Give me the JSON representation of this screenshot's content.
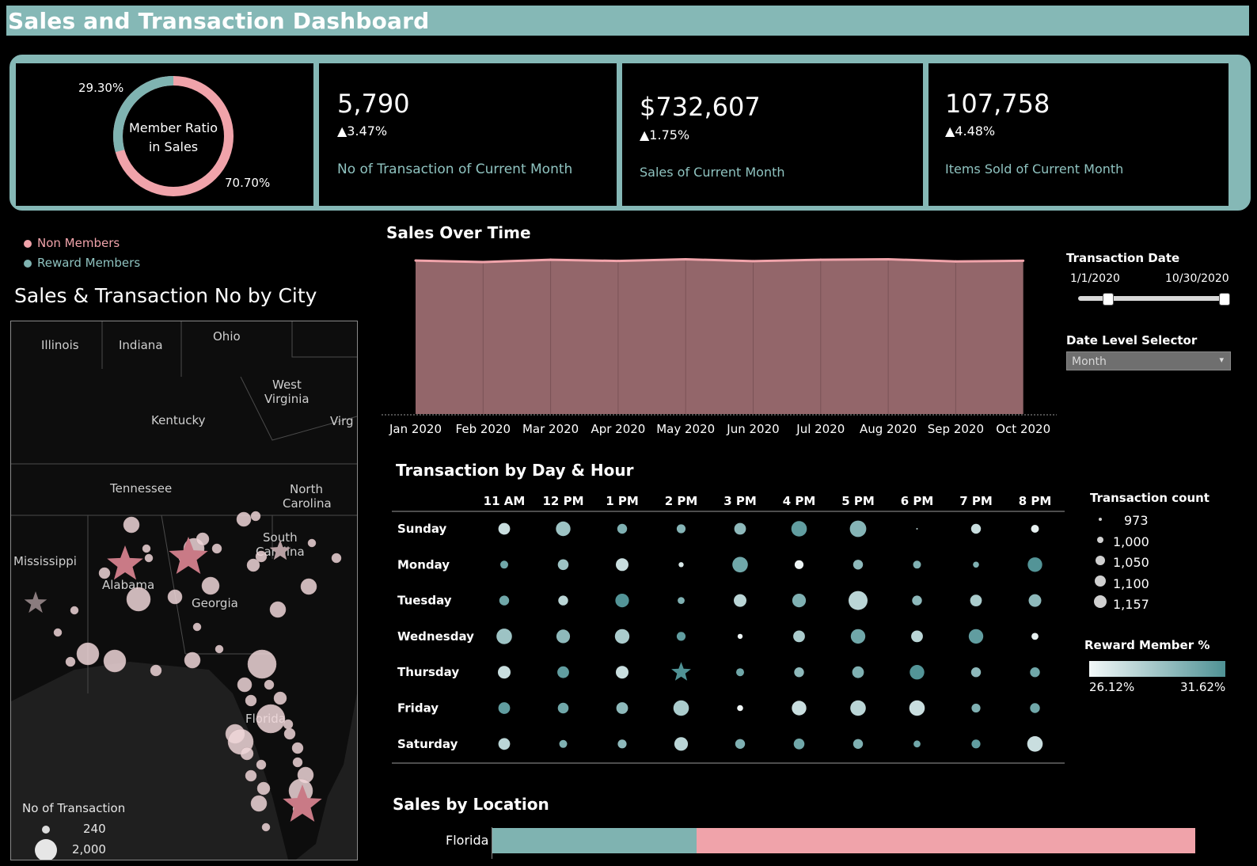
{
  "header": {
    "title": "Sales and Transaction Dashboard"
  },
  "colors": {
    "non_member": "#f0a3aa",
    "reward_member": "#7fb3b1",
    "accent_teal": "#85b8b6",
    "area_fill": "#93666a",
    "map_bg": "#1f1f1f"
  },
  "kpis": {
    "member_ratio": {
      "label_line1": "Member Ratio",
      "label_line2": "in Sales",
      "reward_pct": "29.30%",
      "non_member_pct": "70.70%",
      "reward_fraction": 0.293
    },
    "transactions": {
      "value": "5,790",
      "delta": "▲3.47%",
      "label": "No of Transaction of Current Month"
    },
    "sales": {
      "value": "$732,607",
      "delta": "▲1.75%",
      "label": "Sales of Current Month"
    },
    "items": {
      "value": "107,758",
      "delta": "▲4.48%",
      "label": "Items Sold of Current Month"
    }
  },
  "legend": {
    "non_members": "Non Members",
    "reward_members": "Reward Members"
  },
  "map": {
    "title": "Sales & Transaction No by City",
    "state_labels": [
      "Illinois",
      "Indiana",
      "Ohio",
      "West",
      "Virginia",
      "Kentucky",
      "Virg",
      "Tennessee",
      "North",
      "Carolina",
      "South",
      "Carolina",
      "Mississippi",
      "Alabama",
      "Georgia",
      "Florida"
    ],
    "size_legend": {
      "title": "No of Transaction",
      "min": "240",
      "max": "2,000"
    }
  },
  "sales_over_time": {
    "title": "Sales Over Time"
  },
  "chart_data": [
    {
      "type": "area",
      "title": "Sales Over Time",
      "x": [
        "Jan 2020",
        "Feb 2020",
        "Mar 2020",
        "Apr 2020",
        "May 2020",
        "Jun 2020",
        "Jul 2020",
        "Aug 2020",
        "Sep 2020",
        "Oct 2020"
      ],
      "values": [
        727000,
        720000,
        731000,
        725000,
        733000,
        724000,
        731000,
        733000,
        723000,
        726000
      ],
      "ylim": [
        0,
        780000
      ],
      "grid": false
    },
    {
      "type": "heatmap",
      "title": "Transaction by Day & Hour",
      "columns": [
        "11 AM",
        "12 PM",
        "1 PM",
        "2 PM",
        "3 PM",
        "4 PM",
        "5 PM",
        "6 PM",
        "7 PM",
        "8 PM"
      ],
      "rows": [
        "Sunday",
        "Monday",
        "Tuesday",
        "Wednesday",
        "Thursday",
        "Friday",
        "Saturday"
      ],
      "transaction_count": [
        [
          1080,
          1110,
          1060,
          1050,
          1080,
          1120,
          1130,
          973,
          1060,
          1040
        ],
        [
          1040,
          1070,
          1090,
          1010,
          1120,
          1050,
          1060,
          1040,
          1020,
          1110
        ],
        [
          1060,
          1060,
          1100,
          1030,
          1090,
          1100,
          1157,
          1060,
          1080,
          1090
        ],
        [
          1120,
          1100,
          1110,
          1050,
          1010,
          1080,
          1110,
          1080,
          1110,
          1030
        ],
        [
          1090,
          1080,
          1090,
          1100,
          1040,
          1060,
          1080,
          1110,
          1060,
          1060
        ],
        [
          1080,
          1070,
          1080,
          1120,
          1020,
          1110,
          1120,
          1120,
          1050,
          1060
        ],
        [
          1080,
          1040,
          1050,
          1100,
          1060,
          1070,
          1060,
          1030,
          1050,
          1120
        ]
      ],
      "reward_member_pct": [
        [
          27.5,
          29.0,
          30.0,
          29.8,
          29.5,
          31.0,
          29.8,
          28.0,
          27.5,
          26.5
        ],
        [
          30.5,
          29.0,
          27.5,
          27.0,
          30.5,
          26.3,
          29.5,
          30.0,
          30.0,
          31.5
        ],
        [
          30.5,
          28.0,
          31.5,
          30.0,
          28.0,
          30.0,
          28.0,
          29.5,
          28.5,
          29.5
        ],
        [
          29.0,
          29.5,
          28.5,
          31.0,
          26.3,
          28.5,
          30.5,
          28.0,
          31.0,
          26.5
        ],
        [
          27.5,
          31.0,
          27.5,
          31.6,
          30.5,
          29.5,
          30.0,
          31.5,
          29.5,
          30.5
        ],
        [
          31.0,
          30.5,
          29.5,
          28.5,
          26.2,
          27.5,
          28.0,
          27.5,
          30.0,
          30.5
        ],
        [
          28.0,
          30.0,
          29.5,
          28.0,
          30.0,
          30.5,
          30.0,
          30.5,
          31.0,
          27.5
        ]
      ],
      "star_cell": [
        "Thursday",
        "2 PM"
      ],
      "size_legend": {
        "title": "Transaction count",
        "values": [
          "973",
          "1,000",
          "1,050",
          "1,100",
          "1,157"
        ]
      },
      "color_legend": {
        "title": "Reward Member %",
        "min": "26.12%",
        "max": "31.62%"
      }
    },
    {
      "type": "bar",
      "title": "Sales by Location",
      "categories": [
        "Florida"
      ],
      "series": [
        {
          "name": "Reward Members",
          "values": [
            0.29
          ]
        },
        {
          "name": "Non Members",
          "values": [
            0.71
          ]
        }
      ]
    }
  ],
  "filters": {
    "transaction_date": {
      "title": "Transaction Date",
      "start": "1/1/2020",
      "end": "10/30/2020"
    },
    "date_level": {
      "title": "Date Level Selector",
      "selected": "Month"
    }
  },
  "sales_by_location": {
    "title": "Sales by Location",
    "first_label": "Florida"
  }
}
